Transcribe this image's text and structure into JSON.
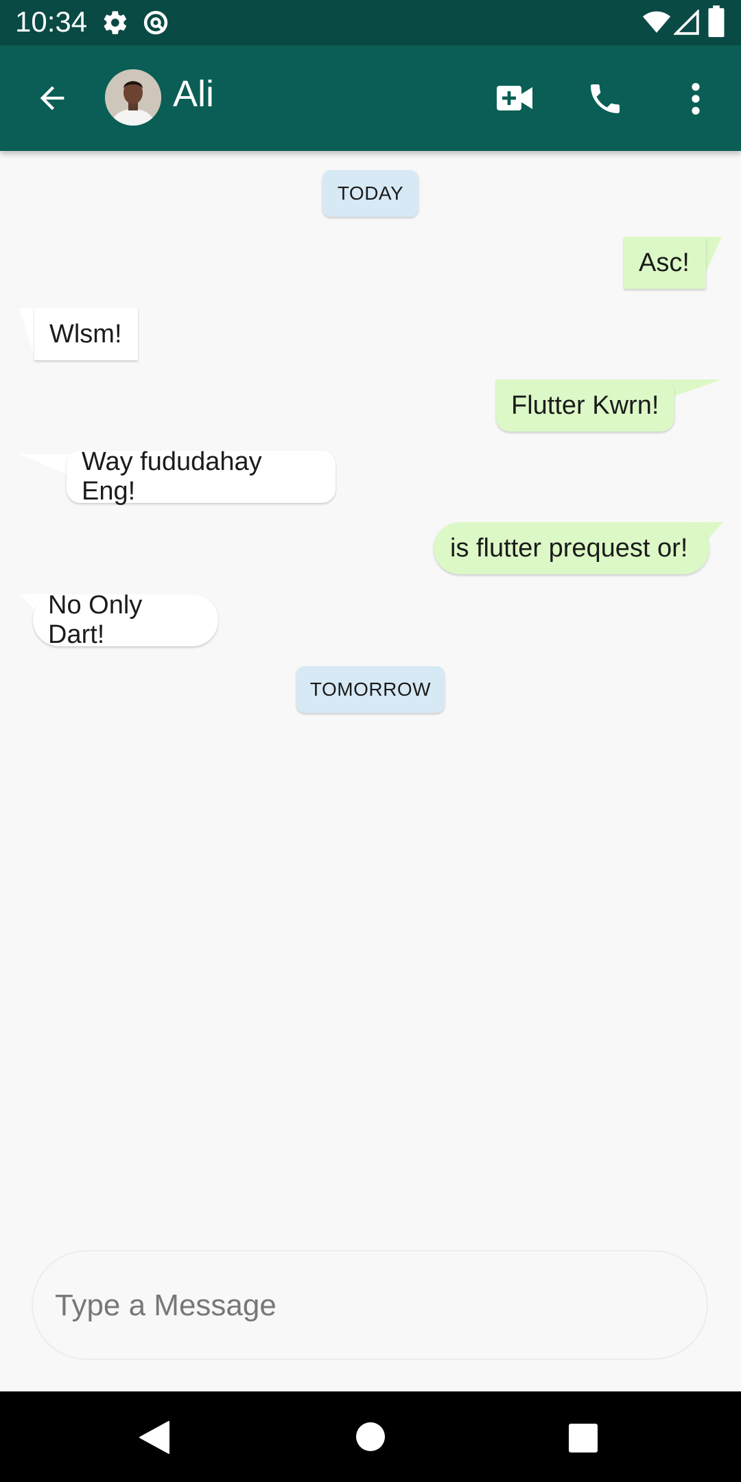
{
  "status_bar": {
    "time": "10:34"
  },
  "header": {
    "contact_name": "Ali"
  },
  "chat": {
    "date_chips": [
      "TODAY",
      "TOMORROW"
    ],
    "messages": [
      {
        "text": "Asc!",
        "direction": "sent"
      },
      {
        "text": "Wlsm!",
        "direction": "received"
      },
      {
        "text": "Flutter Kwrn!",
        "direction": "sent"
      },
      {
        "text": "Way fududahay Eng!",
        "direction": "received"
      },
      {
        "text": "is flutter prequest or!",
        "direction": "sent"
      },
      {
        "text": "No Only Dart!",
        "direction": "received"
      }
    ]
  },
  "composer": {
    "placeholder": "Type a Message",
    "value": ""
  },
  "colors": {
    "app_bar": "#0a5e55",
    "status_bar": "#0a4a44",
    "sent_bubble": "#dcf8c6",
    "received_bubble": "#ffffff",
    "date_chip": "#d6e9f5"
  },
  "icons": [
    "settings-icon",
    "sync-icon",
    "wifi-icon",
    "signal-icon",
    "battery-icon",
    "back-arrow-icon",
    "video-call-icon",
    "phone-icon",
    "more-options-icon",
    "nav-back-icon",
    "nav-home-icon",
    "nav-recents-icon"
  ]
}
